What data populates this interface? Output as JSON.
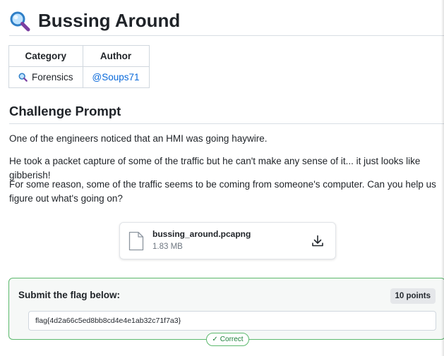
{
  "page": {
    "title": "Bussing Around"
  },
  "meta_table": {
    "headers": [
      "Category",
      "Author"
    ],
    "category": "Forensics",
    "author": "@Soups71"
  },
  "prompt": {
    "heading": "Challenge Prompt",
    "paragraphs": [
      "One of the engineers noticed that an HMI was going haywire.",
      "He took a packet capture of some of the traffic but he can't make any sense of it... it just looks like gibberish!",
      "For some reason, some of the traffic seems to be coming from someone's computer. Can you help us figure out what's going on?"
    ]
  },
  "attachment": {
    "filename": "bussing_around.pcapng",
    "size": "1.83 MB",
    "icon": "download-icon"
  },
  "flag": {
    "label": "Submit the flag below:",
    "points": "10 points",
    "value": "flag{4d2a66c5ed8bb8cd4e4e1ab32c71f7a3}",
    "status": "Correct"
  },
  "colors": {
    "accent_link": "#0969da",
    "success": "#1a7f37",
    "success_border": "#5cb96d",
    "magnifier": "#2f7fc7"
  }
}
